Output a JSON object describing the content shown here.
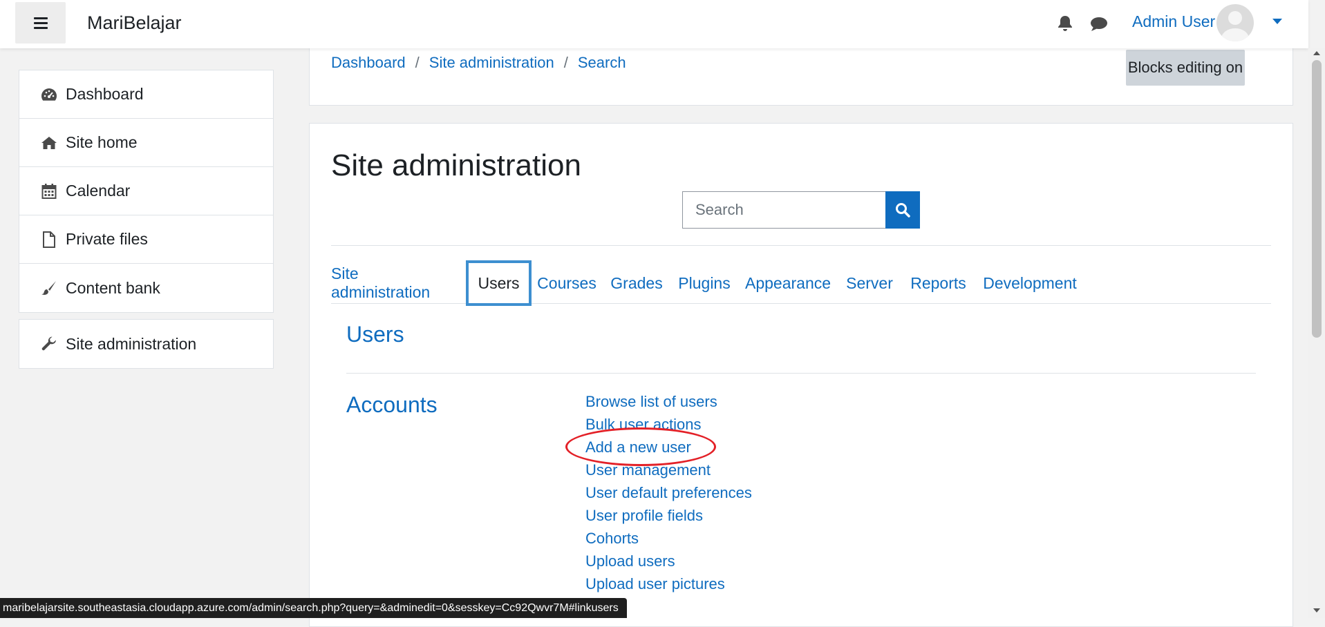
{
  "navbar": {
    "brand": "MariBelajar",
    "user_name": "Admin User",
    "icons": [
      "menu-icon",
      "bell-icon",
      "chat-icon",
      "avatar",
      "chevron-down-icon"
    ]
  },
  "sidebar": {
    "items": [
      {
        "label": "Dashboard",
        "icon": "dashboard-icon"
      },
      {
        "label": "Site home",
        "icon": "home-icon"
      },
      {
        "label": "Calendar",
        "icon": "calendar-icon"
      },
      {
        "label": "Private files",
        "icon": "file-icon"
      },
      {
        "label": "Content bank",
        "icon": "paintbrush-icon"
      }
    ],
    "admin_item": {
      "label": "Site administration",
      "icon": "wrench-icon"
    }
  },
  "breadcrumb": {
    "items": [
      "Dashboard",
      "Site administration",
      "Search"
    ],
    "separator": "/"
  },
  "blocks_button": "Blocks editing on",
  "page": {
    "title": "Site administration",
    "search_placeholder": "Search"
  },
  "tabs": [
    {
      "label": "Site administration",
      "active": false
    },
    {
      "label": "Users",
      "active": true
    },
    {
      "label": "Courses",
      "active": false
    },
    {
      "label": "Grades",
      "active": false
    },
    {
      "label": "Plugins",
      "active": false
    },
    {
      "label": "Appearance",
      "active": false
    },
    {
      "label": "Server",
      "active": false
    },
    {
      "label": "Reports",
      "active": false
    },
    {
      "label": "Development",
      "active": false
    }
  ],
  "content": {
    "section_title": "Users",
    "category_title": "Accounts",
    "links": [
      "Browse list of users",
      "Bulk user actions",
      "Add a new user",
      "User management",
      "User default preferences",
      "User profile fields",
      "Cohorts",
      "Upload users",
      "Upload user pictures"
    ],
    "highlighted_link": "Add a new user"
  },
  "status_bar": "maribelajarsite.southeastasia.cloudapp.azure.com/admin/search.php?query=&adminedit=0&sesskey=Cc92Qwvr7M#linkusers",
  "colors": {
    "link": "#0f6cbf",
    "primary": "#0f6cbf",
    "active_tab_border": "#3d8fd0",
    "highlight_ellipse": "#e32027",
    "page_bg": "#f2f2f2"
  }
}
